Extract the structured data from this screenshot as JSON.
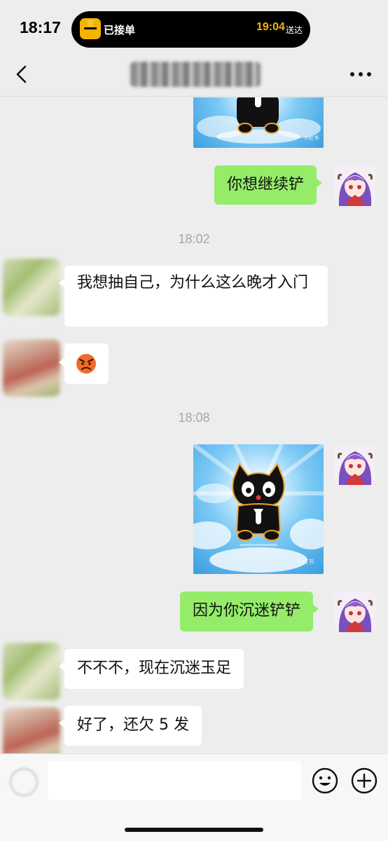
{
  "status_bar": {
    "time": "18:17",
    "live_activity": {
      "label": "已接单",
      "eta": "19:04",
      "eta_suffix": "送达",
      "accent": "#f4b400"
    }
  },
  "nav": {
    "back_icon": "chevron-left-icon",
    "more_icon": "ellipsis-icon"
  },
  "messages": [
    {
      "from": "me",
      "type": "sticker",
      "partial": true
    },
    {
      "from": "me",
      "type": "text",
      "text": "你想继续铲"
    },
    {
      "type": "timestamp",
      "text": "18:02"
    },
    {
      "from": "them",
      "type": "text",
      "text": "我想抽自己，为什么这么晚才入门"
    },
    {
      "from": "them",
      "type": "emoji",
      "emoji": "angry-face"
    },
    {
      "type": "timestamp",
      "text": "18:08"
    },
    {
      "from": "me",
      "type": "sticker",
      "watermark": "小红书"
    },
    {
      "from": "me",
      "type": "text",
      "text": "因为你沉迷铲铲"
    },
    {
      "from": "them",
      "type": "text",
      "text": "不不不，现在沉迷玉足"
    },
    {
      "from": "them",
      "type": "text",
      "text": "好了，还欠 5 发"
    }
  ],
  "input_bar": {
    "voice_icon": "voice-icon",
    "input_value": "",
    "emoji_icon": "smiley-icon",
    "plus_icon": "plus-circle-icon"
  },
  "colors": {
    "my_bubble": "#95ec69",
    "their_bubble": "#ffffff",
    "background": "#ededed"
  }
}
